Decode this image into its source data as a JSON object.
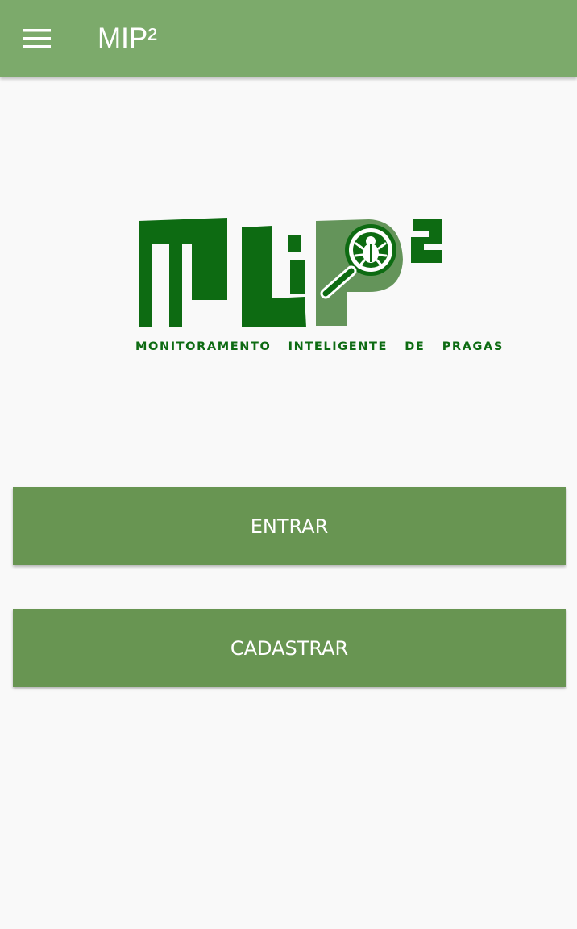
{
  "app_bar": {
    "title": "MIP²",
    "menu_icon": "hamburger-menu-icon",
    "color": "#7caa6b"
  },
  "logo": {
    "subtitle": "MONITORAMENTO  INTELIGENTE  DE  PRAGAS",
    "icon": "bug-magnifier-icon",
    "dark_green": "#0d6b12",
    "light_green": "#64945a"
  },
  "buttons": {
    "login_label": "ENTRAR",
    "register_label": "CADASTRAR",
    "color": "#689552"
  }
}
